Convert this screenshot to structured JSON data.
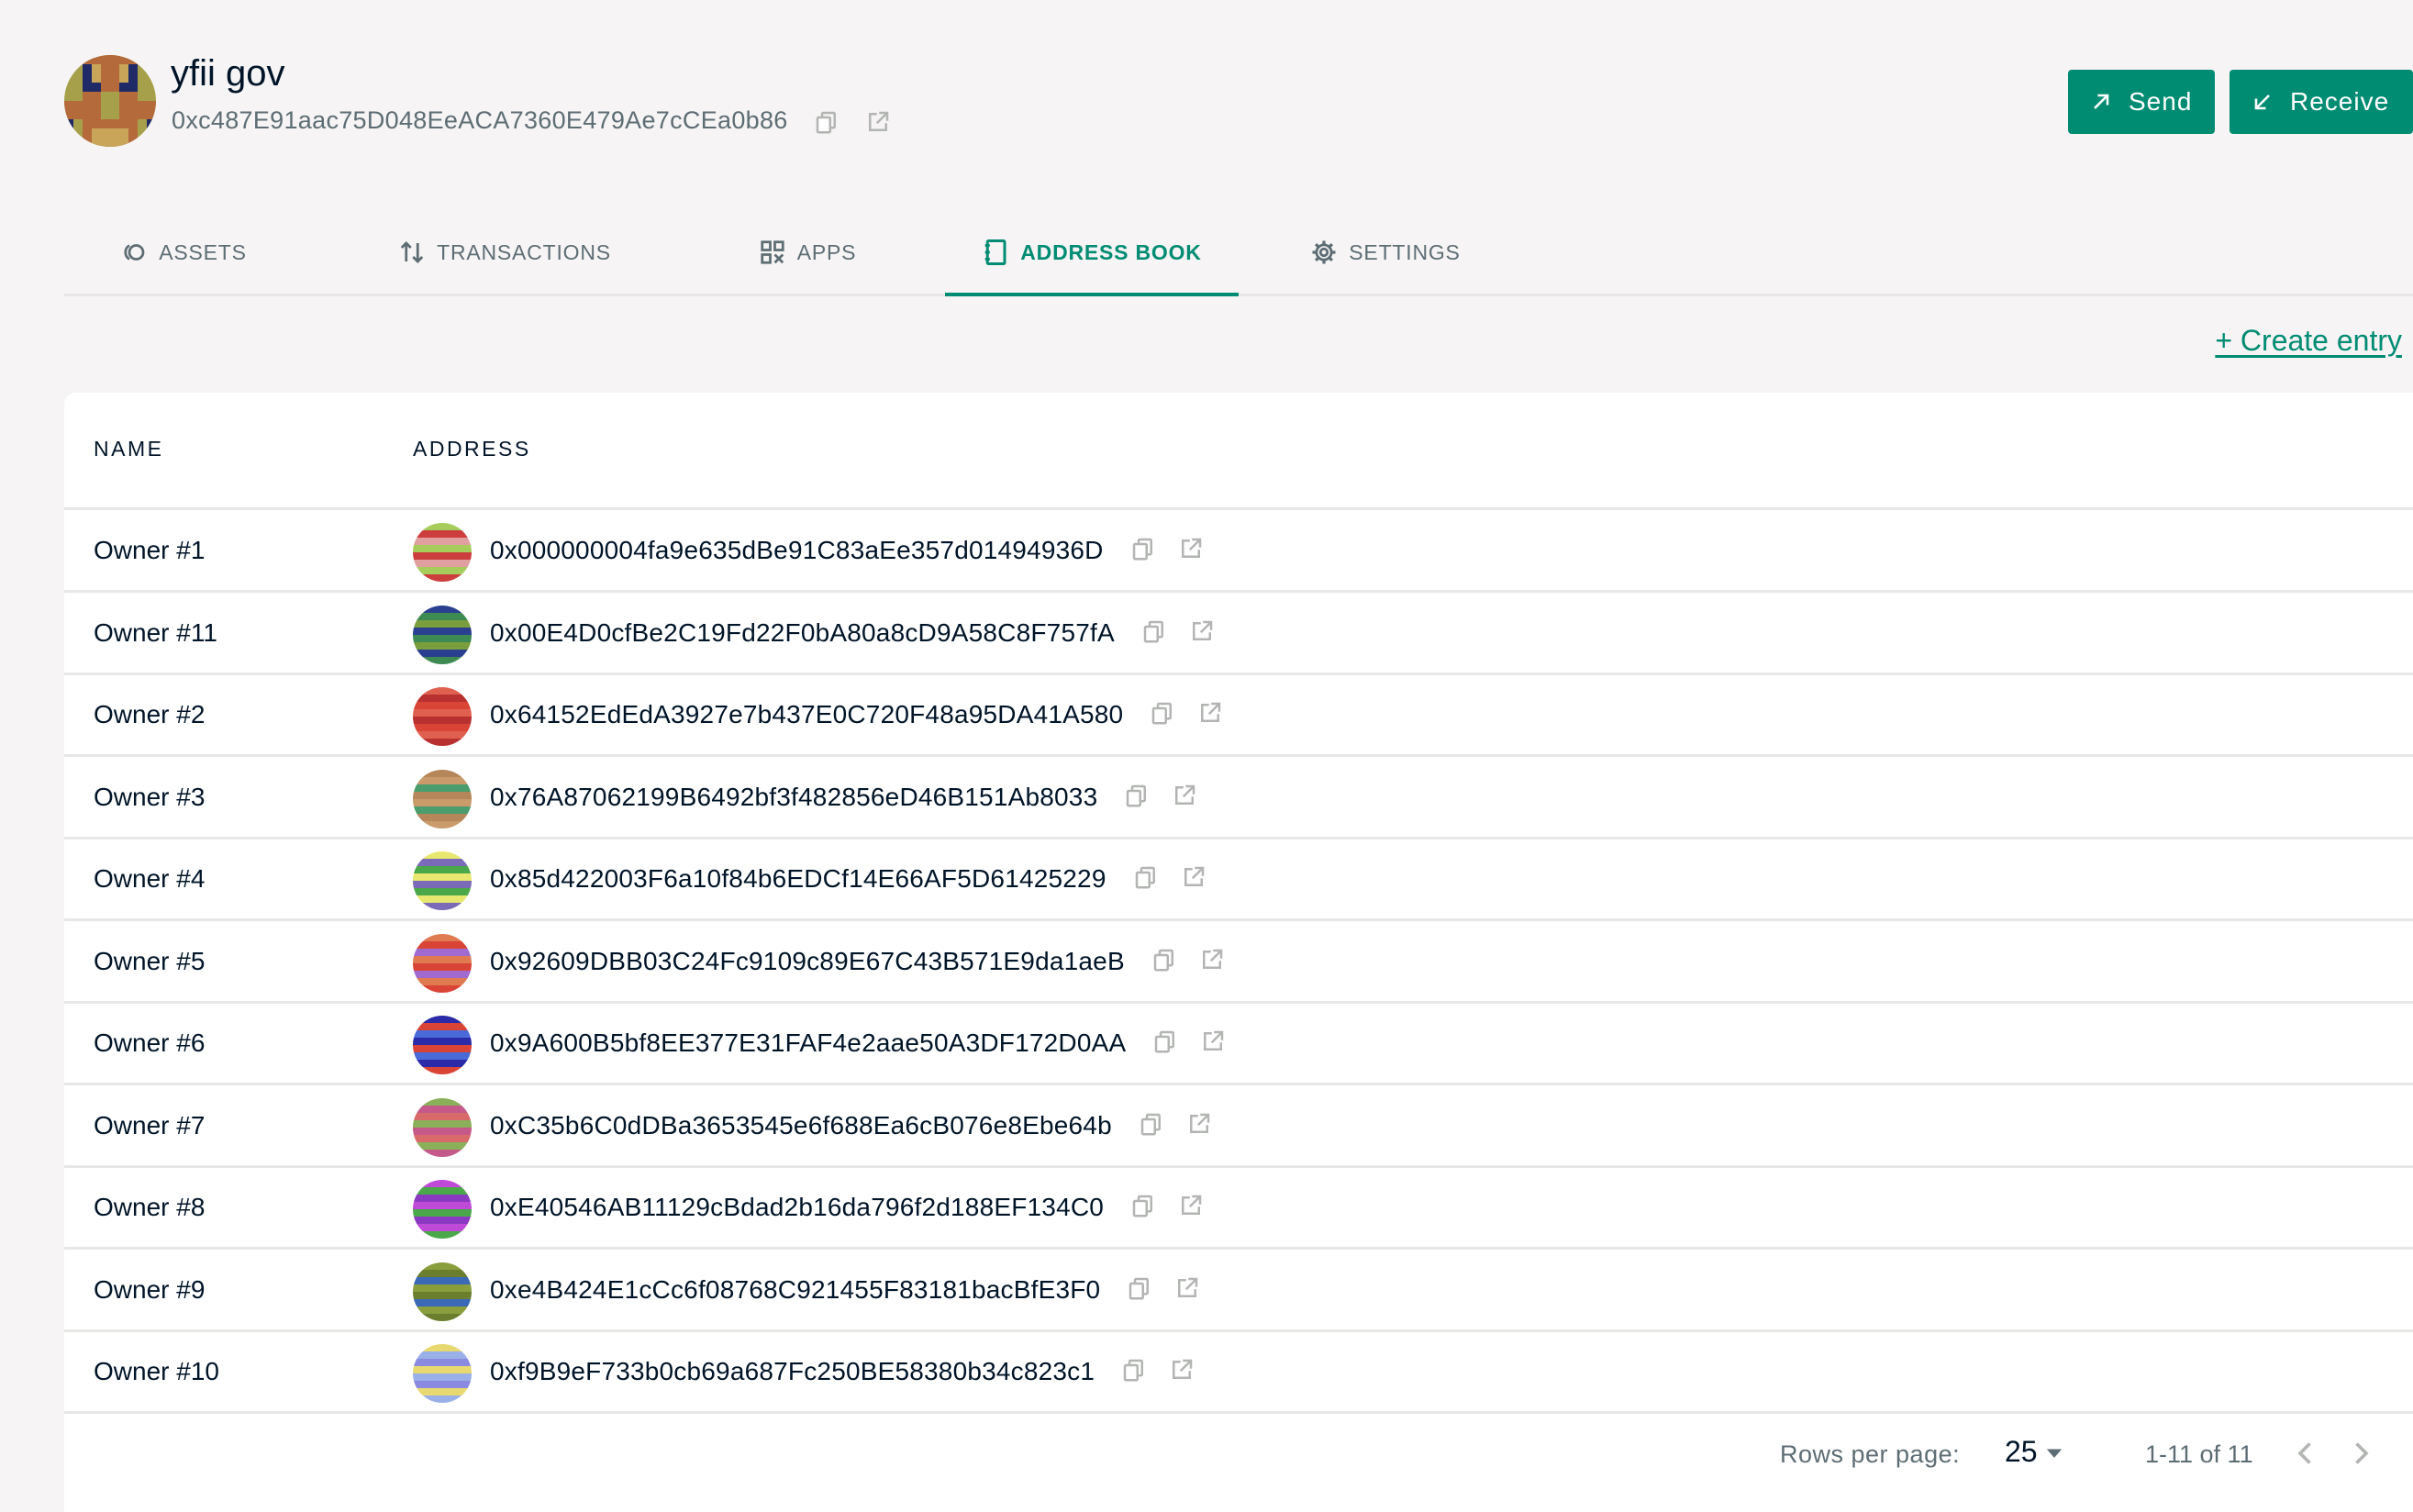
{
  "safe": {
    "name": "yfii gov",
    "address": "0xc487E91aac75D048EeACA7360E479Ae7cCEa0b86"
  },
  "actions": {
    "send_label": "Send",
    "receive_label": "Receive"
  },
  "tabs": [
    {
      "label": "ASSETS",
      "icon": "assets-icon",
      "active": false
    },
    {
      "label": "TRANSACTIONS",
      "icon": "transactions-icon",
      "active": false
    },
    {
      "label": "APPS",
      "icon": "apps-icon",
      "active": false
    },
    {
      "label": "ADDRESS BOOK",
      "icon": "address-book-icon",
      "active": true
    },
    {
      "label": "SETTINGS",
      "icon": "gear-icon",
      "active": false
    }
  ],
  "create_entry_label": "+ Create entry",
  "table": {
    "columns": [
      "NAME",
      "ADDRESS"
    ],
    "rows": [
      {
        "name": "Owner #1",
        "address": "0x000000004fa9e635dBe91C83aEe357d01494936D"
      },
      {
        "name": "Owner #11",
        "address": "0x00E4D0cfBe2C19Fd22F0bA80a8cD9A58C8F757fA"
      },
      {
        "name": "Owner #2",
        "address": "0x64152EdEdA3927e7b437E0C720F48a95DA41A580"
      },
      {
        "name": "Owner #3",
        "address": "0x76A87062199B6492bf3f482856eD46B151Ab8033"
      },
      {
        "name": "Owner #4",
        "address": "0x85d422003F6a10f84b6EDCf14E66AF5D61425229"
      },
      {
        "name": "Owner #5",
        "address": "0x92609DBB03C24Fc9109c89E67C43B571E9da1aeB"
      },
      {
        "name": "Owner #6",
        "address": "0x9A600B5bf8EE377E31FAF4e2aae50A3DF172D0AA"
      },
      {
        "name": "Owner #7",
        "address": "0xC35b6C0dDBa3653545e6f688Ea6cB076e8Ebe64b"
      },
      {
        "name": "Owner #8",
        "address": "0xE40546AB11129cBdad2b16da796f2d188EF134C0"
      },
      {
        "name": "Owner #9",
        "address": "0xe4B424E1cCc6f08768C921455F83181bacBfE3F0"
      },
      {
        "name": "Owner #10",
        "address": "0xf9B9eF733b0cb69a687Fc250BE58380b34c823c1"
      }
    ]
  },
  "pagination": {
    "rows_per_page_label": "Rows per page:",
    "rows_per_page": "25",
    "range": "1-11 of 11"
  },
  "colors": {
    "accent": "#008c73",
    "text": "#001428",
    "muted": "#5d6d74",
    "background": "#f6f4f4"
  }
}
